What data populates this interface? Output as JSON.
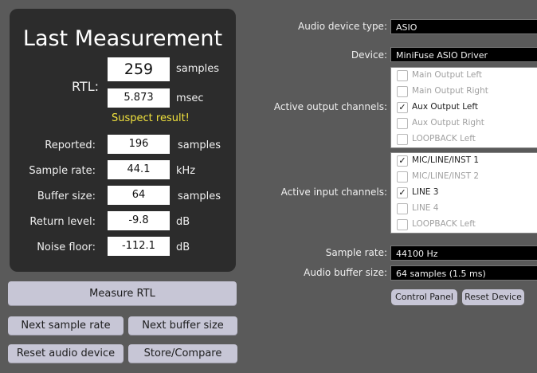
{
  "measurement": {
    "title": "Last Measurement",
    "rtl_label": "RTL:",
    "rtl_samples": "259",
    "rtl_samples_unit": "samples",
    "rtl_msec": "5.873",
    "rtl_msec_unit": "msec",
    "warning": "Suspect result!",
    "rows": [
      {
        "label": "Reported:",
        "value": "196",
        "unit": "samples"
      },
      {
        "label": "Sample rate:",
        "value": "44.1",
        "unit": "kHz"
      },
      {
        "label": "Buffer size:",
        "value": "64",
        "unit": "samples"
      },
      {
        "label": "Return level:",
        "value": "-9.8",
        "unit": "dB"
      },
      {
        "label": "Noise floor:",
        "value": "-112.1",
        "unit": "dB"
      }
    ]
  },
  "buttons": {
    "measure": "Measure RTL",
    "next_sample_rate": "Next sample rate",
    "next_buffer_size": "Next buffer size",
    "reset_audio_device": "Reset audio device",
    "store_compare": "Store/Compare"
  },
  "settings": {
    "device_type_label": "Audio device type:",
    "device_type_value": "ASIO",
    "device_label": "Device:",
    "device_value": "MiniFuse ASIO Driver",
    "output_label": "Active output channels:",
    "outputs": [
      {
        "name": "Main Output Left",
        "checked": false
      },
      {
        "name": "Main Output Right",
        "checked": false
      },
      {
        "name": "Aux Output Left",
        "checked": true
      },
      {
        "name": "Aux Output Right",
        "checked": false
      },
      {
        "name": "LOOPBACK Left",
        "checked": false
      }
    ],
    "input_label": "Active input channels:",
    "inputs": [
      {
        "name": "MIC/LINE/INST 1",
        "checked": true
      },
      {
        "name": "MIC/LINE/INST 2",
        "checked": false
      },
      {
        "name": "LINE 3",
        "checked": true
      },
      {
        "name": "LINE 4",
        "checked": false
      },
      {
        "name": "LOOPBACK Left",
        "checked": false
      }
    ],
    "sample_rate_label": "Sample rate:",
    "sample_rate_value": "44100 Hz",
    "buffer_label": "Audio buffer size:",
    "buffer_value": "64 samples (1.5 ms)",
    "control_panel": "Control Panel",
    "reset_device": "Reset Device"
  }
}
